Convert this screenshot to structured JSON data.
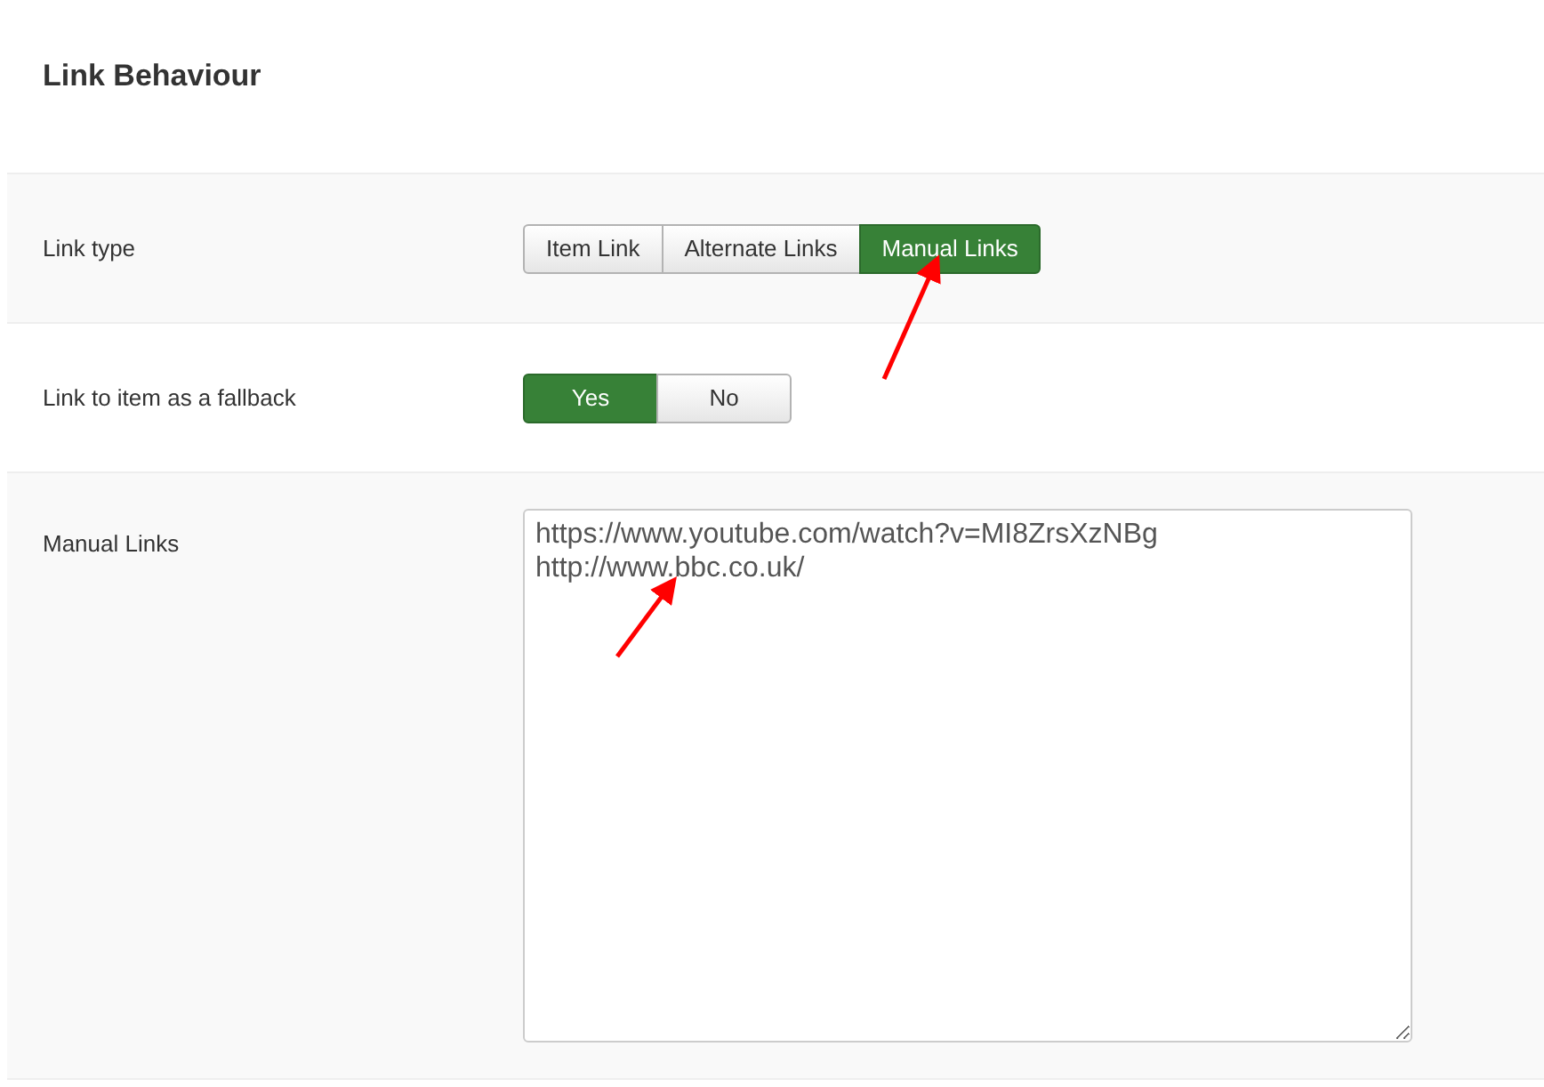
{
  "title": "Link Behaviour",
  "fields": [
    {
      "kind": "buttons",
      "label": "Link type",
      "options": [
        {
          "label": "Item Link",
          "selected": false
        },
        {
          "label": "Alternate Links",
          "selected": false
        },
        {
          "label": "Manual Links",
          "selected": true
        }
      ]
    },
    {
      "kind": "buttons",
      "label": "Link to item as a fallback",
      "options": [
        {
          "label": "Yes",
          "selected": true
        },
        {
          "label": "No",
          "selected": false
        }
      ]
    },
    {
      "kind": "textarea",
      "label": "Manual Links",
      "value": "https://www.youtube.com/watch?v=MI8ZrsXzNBg\nhttp://www.bbc.co.uk/"
    }
  ]
}
